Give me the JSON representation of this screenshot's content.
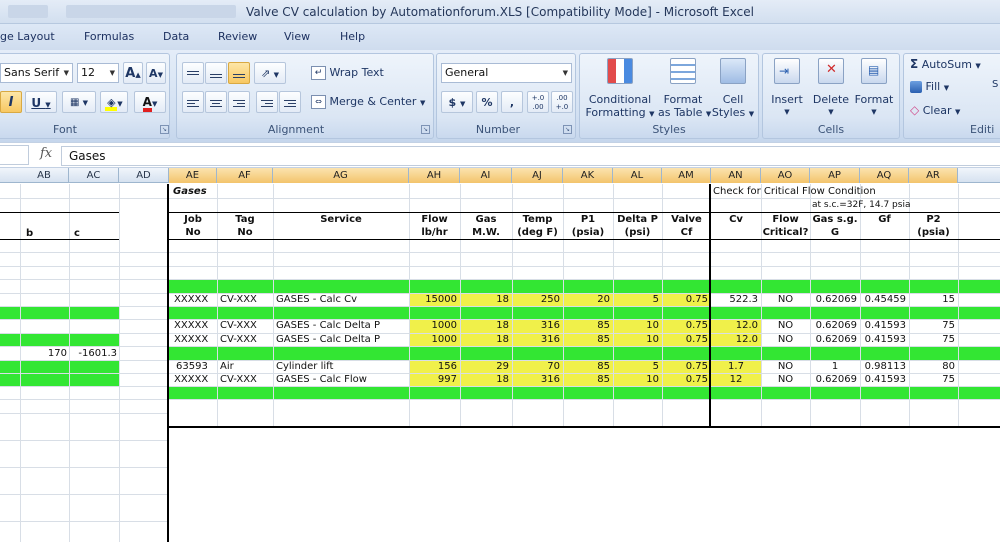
{
  "window": {
    "title": "Valve CV calculation by Automationforum.XLS  [Compatibility Mode] - Microsoft Excel"
  },
  "menu": {
    "tabs": [
      "ge Layout",
      "Formulas",
      "Data",
      "Review",
      "View",
      "Help"
    ]
  },
  "ribbon": {
    "font": {
      "name": "Sans Serif",
      "size": "12",
      "label": "Font"
    },
    "alignment": {
      "wrap_text": "Wrap Text",
      "merge_center": "Merge & Center",
      "label": "Alignment"
    },
    "number": {
      "format": "General",
      "currency": "$",
      "percent": "%",
      "comma": ",",
      "inc_dec": "+.0 .00",
      "dec_dec": ".00 +.0",
      "label": "Number"
    },
    "styles": {
      "conditional": "Conditional",
      "conditional2": "Formatting",
      "format_table": "Format",
      "format_table2": "as Table",
      "cell_styles": "Cell",
      "cell_styles2": "Styles",
      "label": "Styles"
    },
    "cells": {
      "insert": "Insert",
      "delete": "Delete",
      "format": "Format",
      "label": "Cells"
    },
    "editing": {
      "autosum": "AutoSum",
      "fill": "Fill",
      "clear": "Clear",
      "label": "Editi",
      "sort": "S"
    }
  },
  "formula_bar": {
    "fx": "fx",
    "value": "Gases"
  },
  "columns": [
    "AB",
    "AC",
    "AD",
    "AE",
    "AF",
    "AG",
    "AH",
    "AI",
    "AJ",
    "AK",
    "AL",
    "AM",
    "AN",
    "AO",
    "AP",
    "AQ",
    "AR"
  ],
  "sheet": {
    "section_title": "Gases",
    "critical_check": "Check for Critical Flow Condition",
    "std_conditions": "at s.c.=32F, 14.7 psia",
    "left_b": "b",
    "left_c": "c",
    "left_val1": "170",
    "left_val2": "-1601.3",
    "headers": {
      "job1": "Job",
      "job2": "No",
      "tag1": "Tag",
      "tag2": "No",
      "service": "Service",
      "flow1": "Flow",
      "flow2": "lb/hr",
      "gas1": "Gas",
      "gas2": "M.W.",
      "temp1": "Temp",
      "temp2": "(deg F)",
      "p11": "P1",
      "p12": "(psia)",
      "dp1": "Delta P",
      "dp2": "(psi)",
      "valve1": "Valve",
      "valve2": "Cf",
      "cv": "Cv",
      "fc1": "Flow",
      "fc2": "Critical?",
      "sg1": "Gas s.g.",
      "sg2": "G",
      "gf": "Gf",
      "p21": "P2",
      "p22": "(psia)"
    },
    "rows": [
      {
        "job": "XXXXX",
        "tag": "CV-XXX",
        "service": "GASES - Calc Cv",
        "flow": "15000",
        "mw": "18",
        "temp": "250",
        "p1": "20",
        "dp": "5",
        "cf": "0.75",
        "cv": "522.3",
        "crit": "NO",
        "sg": "0.62069",
        "gf": "0.45459",
        "p2": "15"
      },
      {
        "job": "XXXXX",
        "tag": "CV-XXX",
        "service": "GASES - Calc Delta P",
        "flow": "1000",
        "mw": "18",
        "temp": "316",
        "p1": "85",
        "dp": "10",
        "cf": "0.75",
        "cv": "12.0",
        "crit": "NO",
        "sg": "0.62069",
        "gf": "0.41593",
        "p2": "75"
      },
      {
        "job": "XXXXX",
        "tag": "CV-XXX",
        "service": "GASES - Calc Delta P",
        "flow": "1000",
        "mw": "18",
        "temp": "316",
        "p1": "85",
        "dp": "10",
        "cf": "0.75",
        "cv": "12.0",
        "crit": "NO",
        "sg": "0.62069",
        "gf": "0.41593",
        "p2": "75"
      },
      {
        "job": "63593",
        "tag": "Air",
        "service": "Cylinder lift",
        "flow": "156",
        "mw": "29",
        "temp": "70",
        "p1": "85",
        "dp": "5",
        "cf": "0.75",
        "cv": "1.7",
        "crit": "NO",
        "sg": "1",
        "gf": "0.98113",
        "p2": "80"
      },
      {
        "job": "XXXXX",
        "tag": "CV-XXX",
        "service": "GASES - Calc Flow",
        "flow": "997",
        "mw": "18",
        "temp": "316",
        "p1": "85",
        "dp": "10",
        "cf": "0.75",
        "cv": "12",
        "crit": "NO",
        "sg": "0.62069",
        "gf": "0.41593",
        "p2": "75"
      }
    ]
  },
  "colors": {
    "green_fill": "#33e633",
    "yellow_fill": "#f0f04a",
    "ribbon_bg": "#dbe6f4"
  }
}
